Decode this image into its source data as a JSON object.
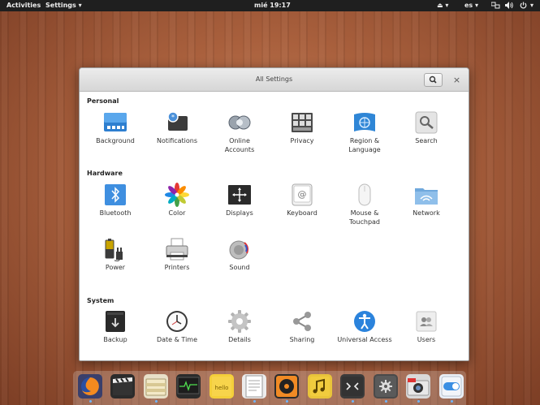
{
  "topbar": {
    "activities": "Activities",
    "app_menu": "Settings",
    "app_menu_arrow": "▾",
    "clock": "mié 19:17",
    "eject": "⏏",
    "eject_arrow": "▾",
    "keyboard_layout": "es",
    "keyboard_arrow": "▾",
    "network_icon": "network-icon",
    "volume_icon": "volume-icon",
    "power_icon": "power-icon",
    "system_arrow": "▾"
  },
  "window": {
    "title": "All Settings",
    "close": "×",
    "sections": {
      "personal": "Personal",
      "hardware": "Hardware",
      "system": "System"
    },
    "items": {
      "background": "Background",
      "notifications": "Notifications",
      "online_accounts_1": "Online",
      "online_accounts_2": "Accounts",
      "privacy": "Privacy",
      "region_1": "Region &",
      "region_2": "Language",
      "search": "Search",
      "bluetooth": "Bluetooth",
      "color": "Color",
      "displays": "Displays",
      "keyboard": "Keyboard",
      "mouse_1": "Mouse &",
      "mouse_2": "Touchpad",
      "network": "Network",
      "power": "Power",
      "printers": "Printers",
      "sound": "Sound",
      "backup": "Backup",
      "datetime": "Date & Time",
      "details": "Details",
      "sharing": "Sharing",
      "universal_access": "Universal Access",
      "users": "Users"
    }
  },
  "dock": {
    "apps": [
      "firefox-icon",
      "video-icon",
      "files-icon",
      "system-monitor-icon",
      "notes-icon",
      "text-editor-icon",
      "music-player-icon",
      "audio-icon",
      "terminal-icon",
      "settings-icon",
      "camera-icon",
      "toggle-icon"
    ],
    "running": [
      0,
      2,
      5,
      6,
      8,
      9,
      10,
      11
    ]
  },
  "colors": {
    "topbar": "#1f1f1f",
    "accent": "#4a90d9",
    "running_dot": "#6fb6ff"
  }
}
